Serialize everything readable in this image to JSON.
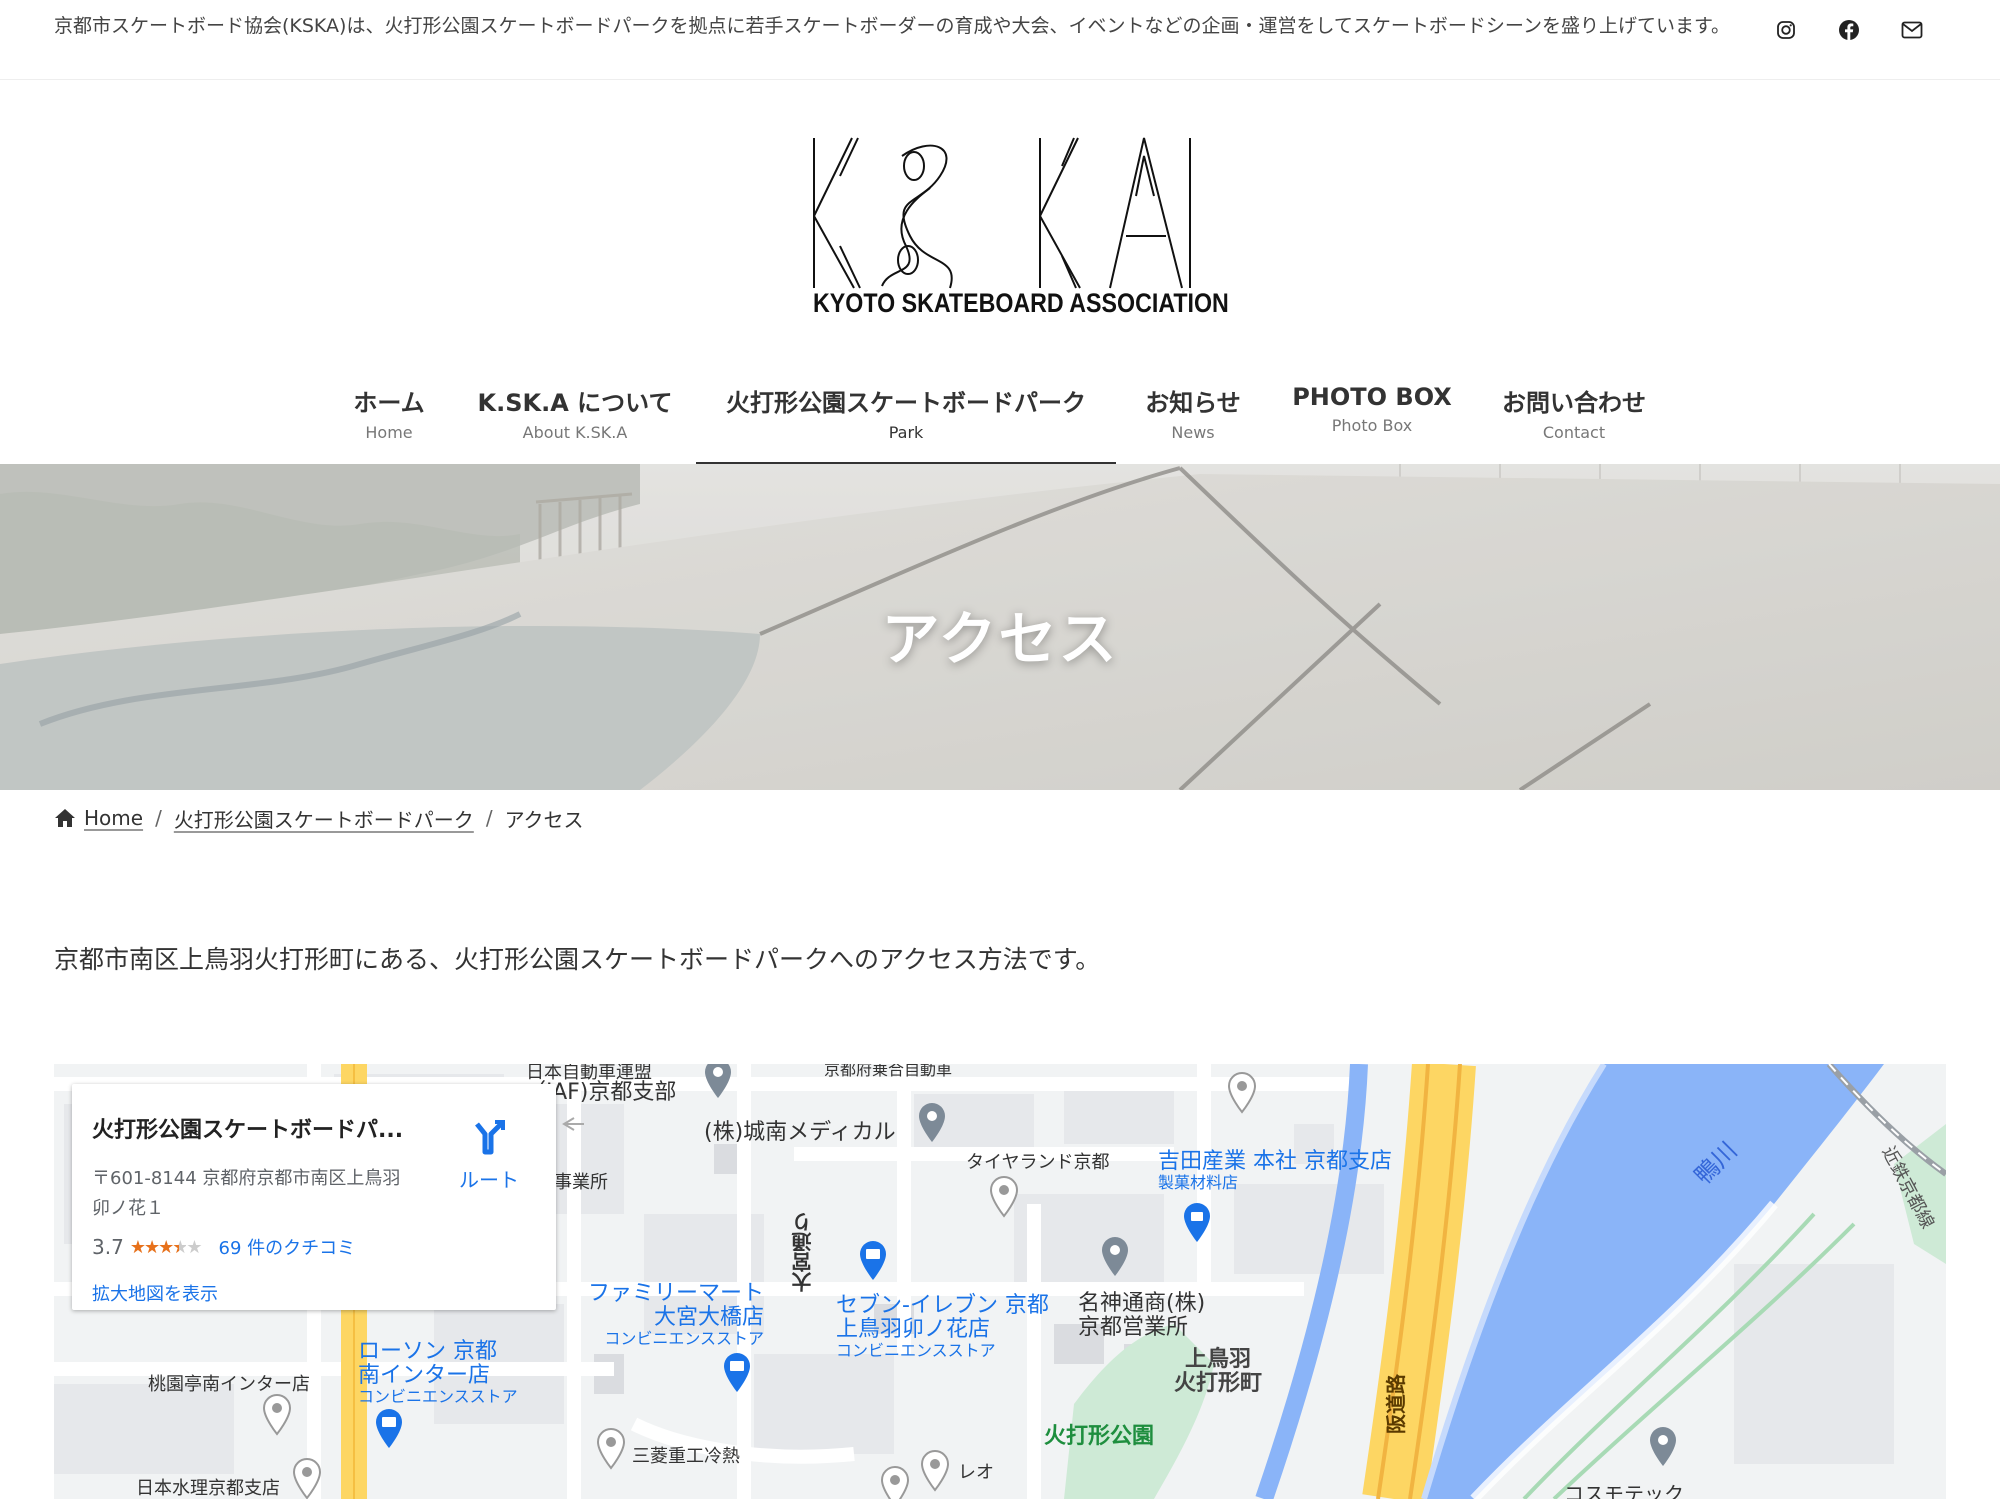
{
  "topbar": {
    "description": "京都市スケートボード協会(KSKA)は、火打形公園スケートボードパークを拠点に若手スケートボーダーの育成や大会、イベントなどの企画・運営をしてスケートボードシーンを盛り上げています。",
    "social_icons": [
      "instagram-icon",
      "facebook-icon",
      "mail-icon"
    ]
  },
  "logo": {
    "wordmark": "K.SK.A",
    "tagline": "KYOTO SKATEBOARD ASSOCIATION"
  },
  "nav": {
    "items": [
      {
        "ja": "ホーム",
        "en": "Home"
      },
      {
        "ja": "K.SK.A について",
        "en": "About K.SK.A"
      },
      {
        "ja": "火打形公園スケートボードパーク",
        "en": "Park"
      },
      {
        "ja": "お知らせ",
        "en": "News"
      },
      {
        "ja": "PHOTO BOX",
        "en": "Photo Box"
      },
      {
        "ja": "お問い合わせ",
        "en": "Contact"
      }
    ],
    "active_index": 2
  },
  "hero": {
    "title": "アクセス"
  },
  "breadcrumb": {
    "home": "Home",
    "parent": "火打形公園スケートボードパーク",
    "current": "アクセス",
    "separator": "/"
  },
  "intro": "京都市南区上鳥羽火打形町にある、火打形公園スケートボードパークへのアクセス方法です。",
  "map": {
    "card": {
      "name": "火打形公園スケートボードパ...",
      "address_line1": "〒601-8144 京都府京都市南区上鳥羽",
      "address_line2": "卯ノ花１",
      "rating": "3.7",
      "stars_filled": 3.5,
      "reviews": "69 件のクチコミ",
      "view_larger": "拡大地図を表示",
      "route": "ルート"
    },
    "labels": {
      "jaf": "（JAF)京都支部",
      "jaf_top": "日本自動車連盟",
      "jonan": "(株)城南メディカル",
      "jigyosho": "事業所",
      "tireland": "タイヤランド京都",
      "yoshida": "吉田産業 本社 京都支店",
      "yoshida_sub": "製菓材料店",
      "omiya_dori": "大宮通り",
      "famima1": "ファミリーマート",
      "famima2": "大宮大橋店",
      "famima_sub": "コンビニエンスストア",
      "seven1": "セブン-イレブン 京都",
      "seven2": "上鳥羽卯ノ花店",
      "seven_sub": "コンビニエンスストア",
      "meishin1": "名神通商(株)",
      "meishin2": "京都営業所",
      "district1": "上鳥羽",
      "district2": "火打形町",
      "lawson1": "ローソン 京都",
      "lawson2": "南インター店",
      "lawson_sub": "コンビニエンスストア",
      "momozono": "桃園亭南インター店",
      "nihonsuiri": "日本水理京都支店",
      "mitsubishi": "三菱重工冷熱",
      "reo": "レオ",
      "park": "火打形公園",
      "hanshin": "阪道路",
      "kamogawa": "鴨川",
      "kintetsu": "近鉄京都線",
      "cosmotec": "コスモテック",
      "kyotofu_top": "京都府乗合自動車"
    }
  }
}
